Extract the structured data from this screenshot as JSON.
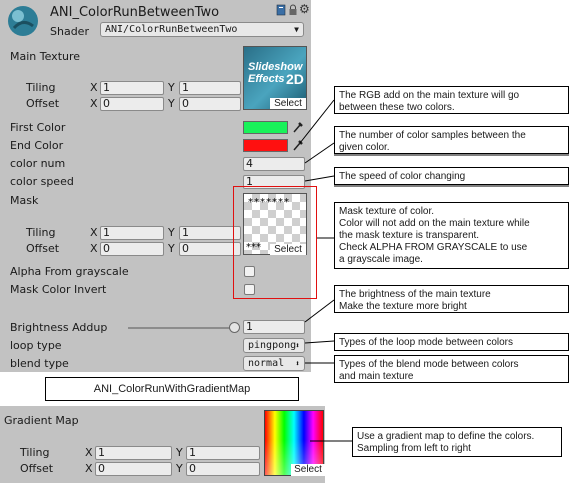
{
  "header": {
    "title": "ANI_ColorRunBetweenTwo",
    "shader_label": "Shader",
    "shader_value": "ANI/ColorRunBetweenTwo"
  },
  "main_texture": {
    "label": "Main Texture",
    "tiling_label": "Tiling",
    "offset_label": "Offset",
    "tiling_x": "1",
    "tiling_y": "1",
    "offset_x": "0",
    "offset_y": "0",
    "x_label": "X",
    "y_label": "Y",
    "thumb_text_1": "Slideshow",
    "thumb_text_2": "Effects",
    "thumb_text_3": "2D",
    "select_label": "Select"
  },
  "first_color": {
    "label": "First Color",
    "color": "#19f25a"
  },
  "end_color": {
    "label": "End Color",
    "color": "#ff1010"
  },
  "color_num": {
    "label": "color num",
    "value": "4"
  },
  "color_speed": {
    "label": "color speed",
    "value": "1"
  },
  "mask": {
    "label": "Mask",
    "tiling_label": "Tiling",
    "offset_label": "Offset",
    "tiling_x": "1",
    "tiling_y": "1",
    "offset_x": "0",
    "offset_y": "0",
    "x_label": "X",
    "y_label": "Y",
    "stars_top": "*******",
    "stars_bottom": "***",
    "select_label": "Select"
  },
  "alpha_from_grayscale": {
    "label": "Alpha From grayscale"
  },
  "mask_color_invert": {
    "label": "Mask Color Invert"
  },
  "brightness": {
    "label": "Brightness Addup",
    "value": "1",
    "slider_fraction": 1.0
  },
  "loop_type": {
    "label": "loop type",
    "value": "pingpong"
  },
  "blend_type": {
    "label": "blend type",
    "value": "normal"
  },
  "variant_button": "ANI_ColorRunWithGradientMap",
  "gradient_map": {
    "label": "Gradient Map",
    "tiling_label": "Tiling",
    "offset_label": "Offset",
    "tiling_x": "1",
    "tiling_y": "1",
    "offset_x": "0",
    "offset_y": "0",
    "x_label": "X",
    "y_label": "Y",
    "select_label": "Select"
  },
  "notes": {
    "main_texture": [
      "The RGB add on the main texture will go",
      "between these two colors."
    ],
    "color_num": [
      "The number of color samples between the",
      "given color."
    ],
    "color_speed": [
      "The speed of color changing"
    ],
    "mask": [
      "Mask texture of color.",
      "Color will not add on the main texture while",
      "the mask texture is transparent.",
      "Check ALPHA FROM GRAYSCALE to use",
      "a grayscale image."
    ],
    "brightness": [
      "The brightness of the main texture",
      "Make the texture more bright"
    ],
    "loop_type": [
      "Types of the loop mode between colors"
    ],
    "blend_type": [
      "Types of the blend mode between colors",
      "and main texture"
    ],
    "gradient": [
      "Use a gradient map to define the colors.",
      "Sampling from left to right"
    ]
  },
  "colors": {
    "panel": "#c2c2c2",
    "mask_box": "#e01010",
    "slider_track": "#8c8c8c"
  },
  "icons": [
    "material-icon",
    "book-help-icon",
    "lock-icon",
    "gear-icon",
    "dropdown-arrow-icon",
    "eyedropper-icon"
  ]
}
